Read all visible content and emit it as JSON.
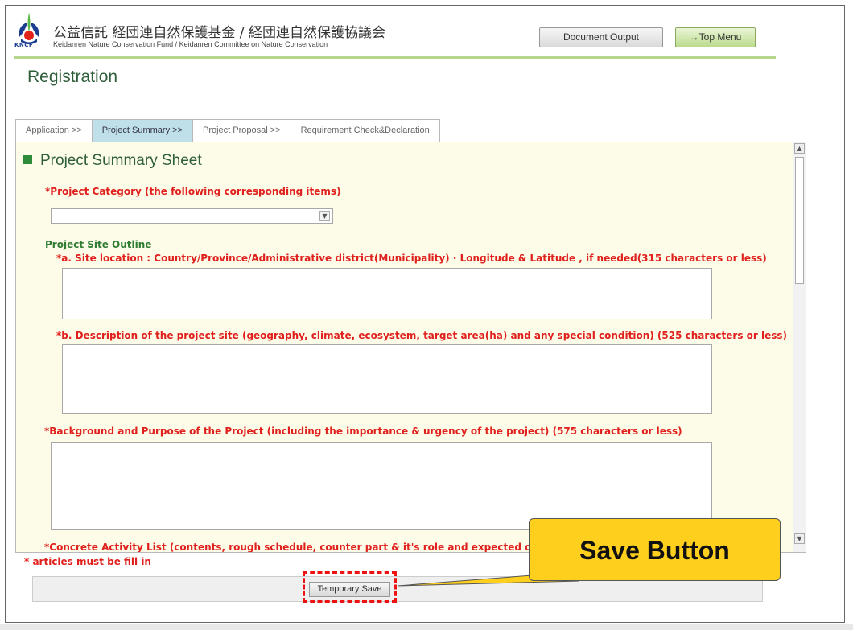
{
  "header": {
    "logo_text": "KNCF",
    "org_title": "公益信託 経団連自然保護基金 / 経団連自然保護協議会",
    "org_subtitle": "Keidanren Nature Conservation Fund / Keidanren Committee on Nature Conservation",
    "document_output_label": "Document Output",
    "top_menu_label": "→Top Menu"
  },
  "page_title": "Registration",
  "tabs": [
    {
      "label": "Application >>",
      "active": false
    },
    {
      "label": "Project Summary >>",
      "active": true
    },
    {
      "label": "Project Proposal >>",
      "active": false
    },
    {
      "label": "Requirement Check&Declaration",
      "active": false
    }
  ],
  "form": {
    "sheet_title": "Project Summary Sheet",
    "project_category_label": "*Project Category (the following corresponding items)",
    "project_category_value": "",
    "site_outline_label": "Project Site Outline",
    "site_location_label": "*a. Site location : Country/Province/Administrative district(Municipality) · Longitude & Latitude , if needed(315 characters or less)",
    "site_location_value": "",
    "site_description_label": "*b. Description of the project site (geography, climate, ecosystem, target area(ha) and any special condition) (525 characters or less)",
    "site_description_value": "",
    "background_label": "*Background and Purpose of the Project (including the importance & urgency of the project) (575 characters or less)",
    "background_value": "",
    "activity_list_label": "*Concrete Activity List  (contents, rough schedule, counter part & it's role and expected outcom"
  },
  "required_note": "* articles must be fill in",
  "footer": {
    "temporary_save_label": "Temporary Save"
  },
  "callout": {
    "text": "Save Button",
    "color": "#ffcf1e"
  },
  "colors": {
    "required_red": "#e0201d",
    "heading_green": "#2f5e3a",
    "active_tab": "#bfe0e9",
    "panel_bg": "#fcfce8"
  }
}
